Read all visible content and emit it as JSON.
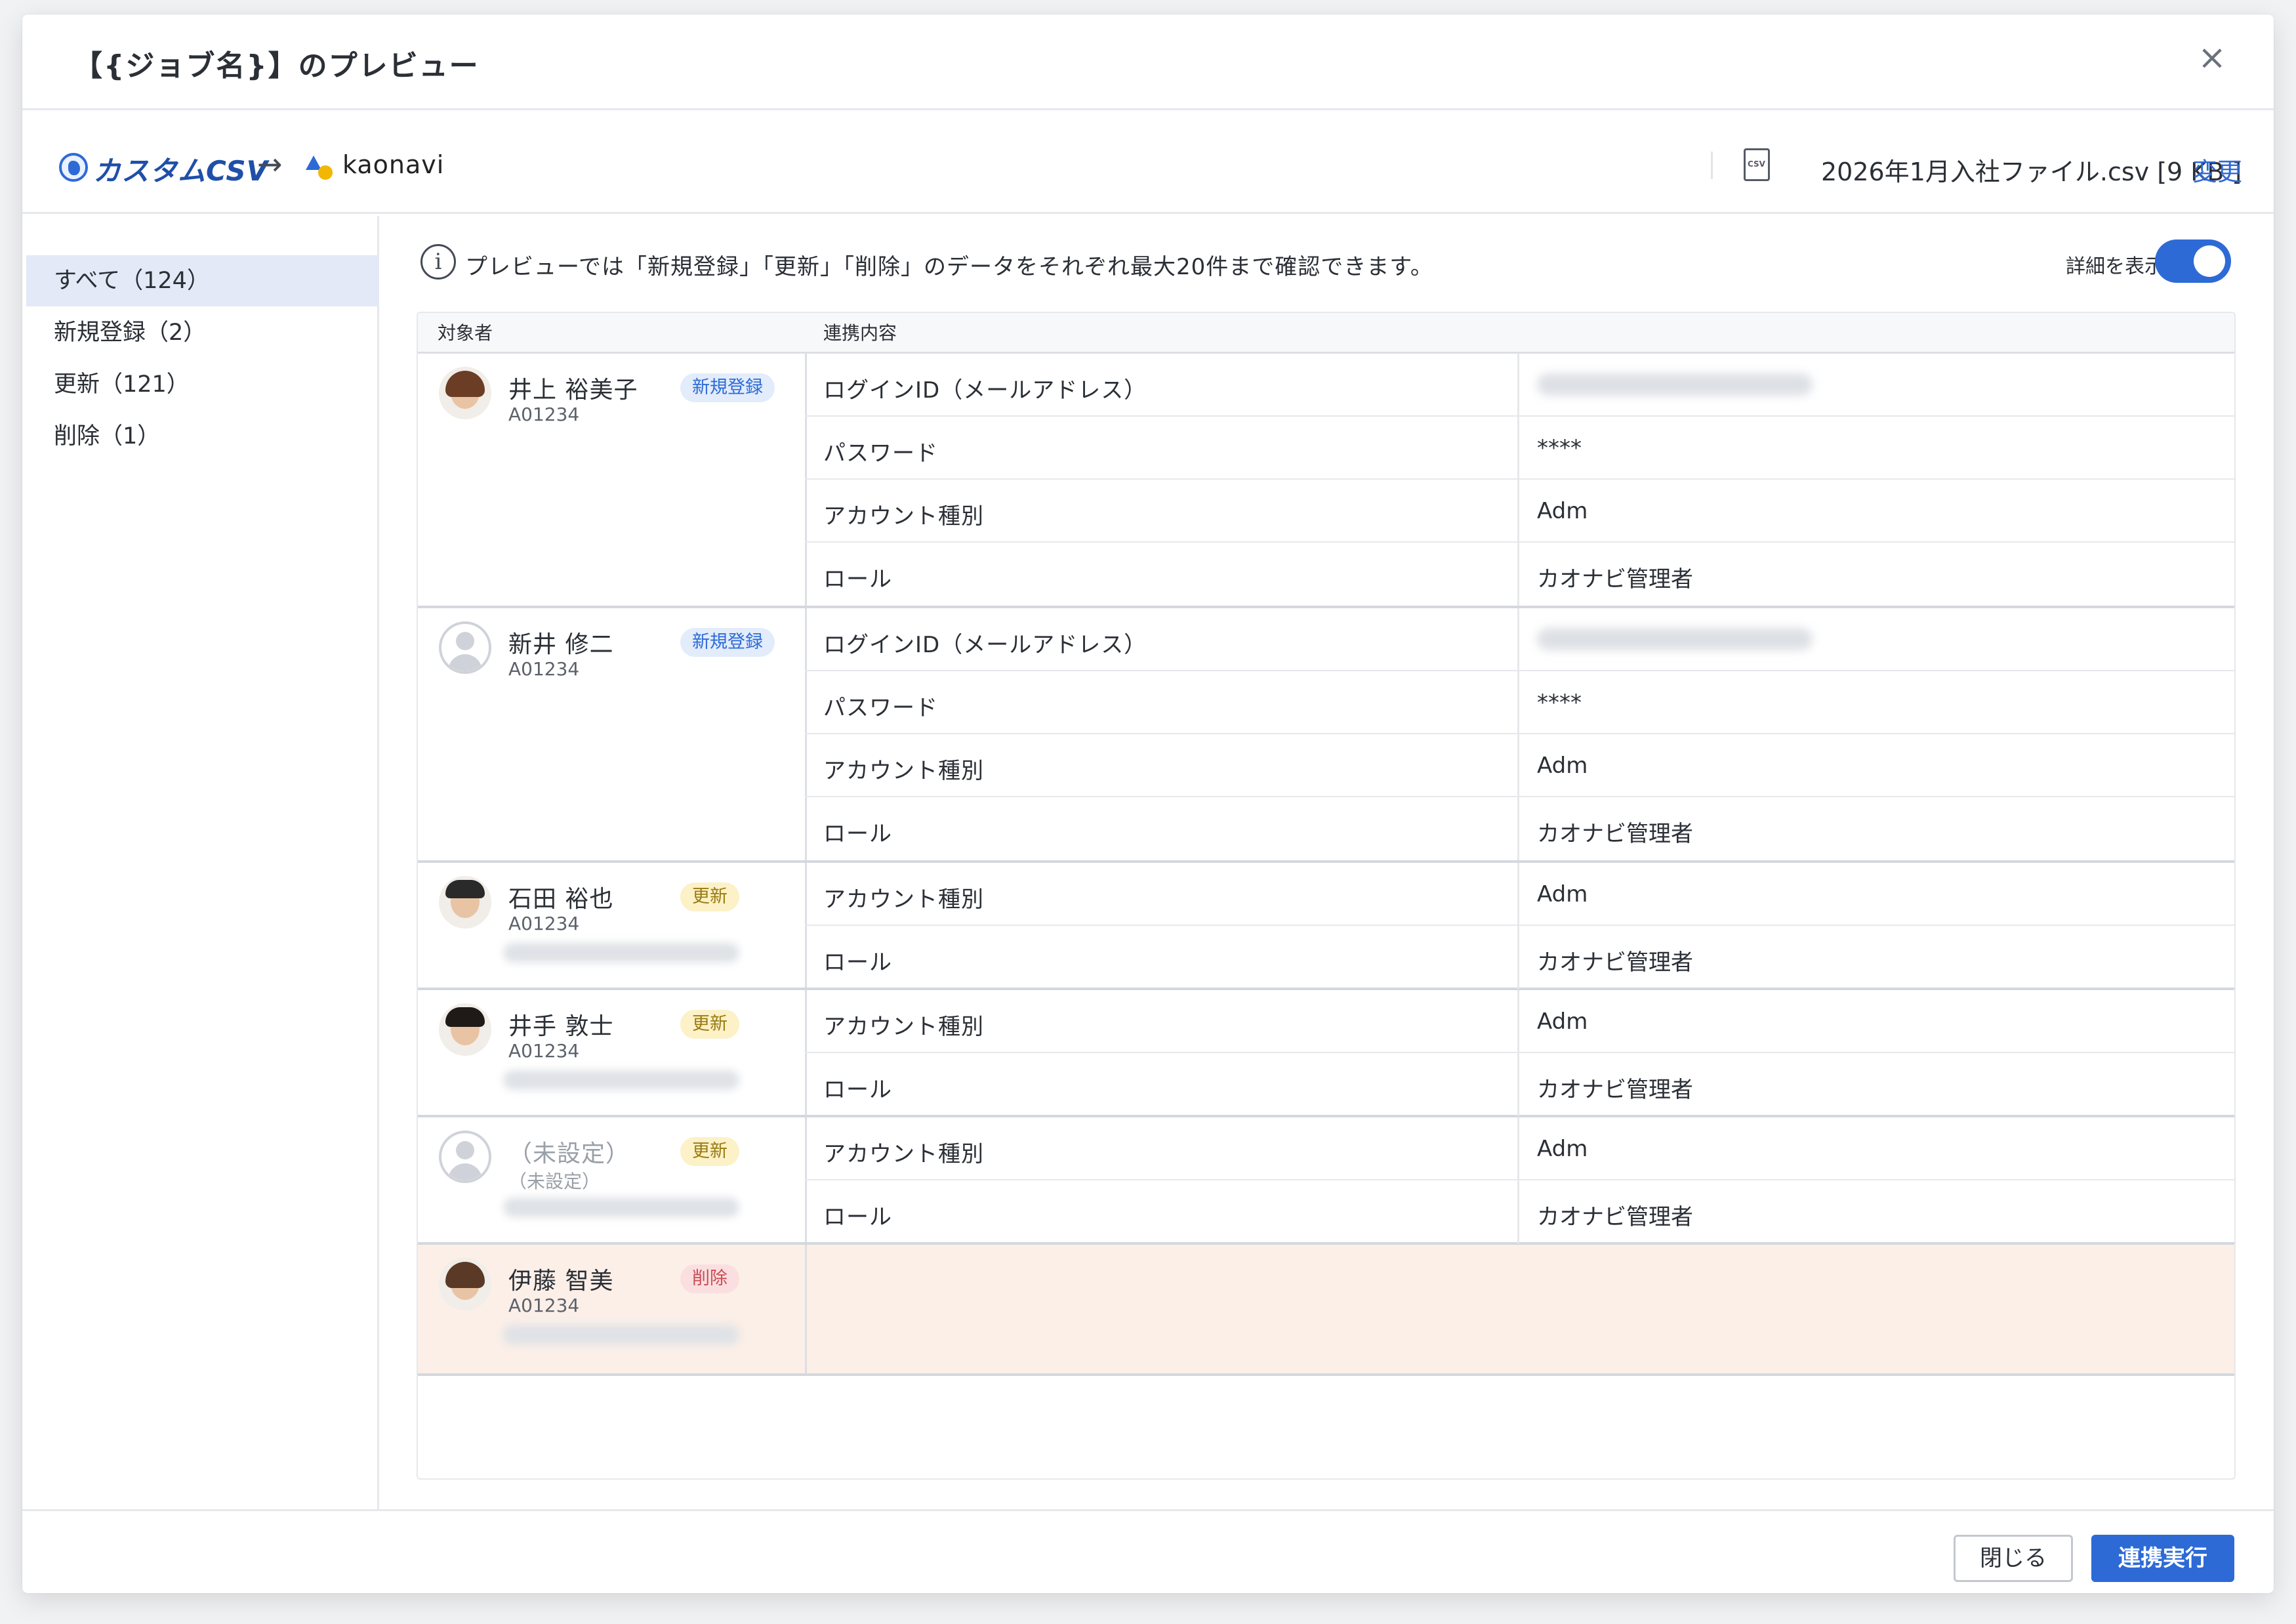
{
  "header": {
    "title": "【{ジョブ名}】のプレビュー",
    "close_icon": "close-icon"
  },
  "connector": {
    "source": "カスタムCSV",
    "arrow": "→",
    "destination": "kaonavi",
    "file_name": "2026年1月入社ファイル.csv [9 KB ]",
    "change_link": "変更"
  },
  "sidebar": {
    "items": [
      {
        "label": "すべて（124）",
        "active": true
      },
      {
        "label": "新規登録（2）",
        "active": false
      },
      {
        "label": "更新（121）",
        "active": false
      },
      {
        "label": "削除（1）",
        "active": false
      }
    ]
  },
  "main": {
    "info_text": "プレビューでは「新規登録」「更新」「削除」のデータをそれぞれ最大20件まで確認できます。",
    "toggle_label": "詳細を表示",
    "toggle_on": true
  },
  "table": {
    "headers": {
      "person": "対象者",
      "content": "連携内容"
    },
    "groups": [
      {
        "name": "井上 裕美子",
        "id": "A01234",
        "badge": "新規登録",
        "badge_type": "new",
        "fields": [
          {
            "key": "ログインID（メールアドレス）",
            "value": ""
          },
          {
            "key": "パスワード",
            "value": "****"
          },
          {
            "key": "アカウント種別",
            "value": "Adm"
          },
          {
            "key": "ロール",
            "value": "カオナビ管理者"
          }
        ]
      },
      {
        "name": "新井 修二",
        "id": "A01234",
        "badge": "新規登録",
        "badge_type": "new",
        "fields": [
          {
            "key": "ログインID（メールアドレス）",
            "value": ""
          },
          {
            "key": "パスワード",
            "value": "****"
          },
          {
            "key": "アカウント種別",
            "value": "Adm"
          },
          {
            "key": "ロール",
            "value": "カオナビ管理者"
          }
        ]
      },
      {
        "name": "石田 裕也",
        "id": "A01234",
        "badge": "更新",
        "badge_type": "upd",
        "fields": [
          {
            "key": "アカウント種別",
            "value": "Adm"
          },
          {
            "key": "ロール",
            "value": "カオナビ管理者"
          }
        ]
      },
      {
        "name": "井手 敦士",
        "id": "A01234",
        "badge": "更新",
        "badge_type": "upd",
        "fields": [
          {
            "key": "アカウント種別",
            "value": "Adm"
          },
          {
            "key": "ロール",
            "value": "カオナビ管理者"
          }
        ]
      },
      {
        "name": "（未設定）",
        "id": "（未設定）",
        "badge": "更新",
        "badge_type": "upd",
        "fields": [
          {
            "key": "アカウント種別",
            "value": "Adm"
          },
          {
            "key": "ロール",
            "value": "カオナビ管理者"
          }
        ]
      },
      {
        "name": "伊藤 智美",
        "id": "A01234",
        "badge": "削除",
        "badge_type": "del",
        "fields": []
      }
    ]
  },
  "footer": {
    "close_label": "閉じる",
    "run_label": "連携実行"
  },
  "colors": {
    "accent": "#2d6ad6",
    "delete_row_bg": "#fbefe8"
  }
}
